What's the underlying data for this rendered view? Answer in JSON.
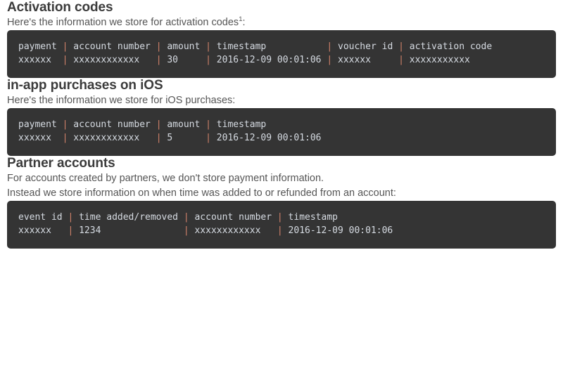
{
  "sections": [
    {
      "heading": "Activation codes",
      "intro_prefix": "Here's the information we store for activation codes",
      "intro_superscript": "1",
      "intro_suffix": ":",
      "code": {
        "header_cells": [
          "payment",
          "account number",
          "amount",
          "timestamp           ",
          "voucher id",
          "activation code"
        ],
        "value_cells": [
          "xxxxxx ",
          "xxxxxxxxxxxx ",
          "30    ",
          "2016-12-09 00:01:06",
          "xxxxxx    ",
          "xxxxxxxxxxx"
        ],
        "header_line": "payment | account number | amount | timestamp           | voucher id | activation code",
        "value_line": "xxxxxx  | xxxxxxxxxxxx   | 30     | 2016-12-09 00:01:06 | xxxxxx     | xxxxxxxxxxx"
      }
    },
    {
      "heading": "in-app purchases on iOS",
      "intro_prefix": "Here's the information we store for iOS purchases:",
      "intro_superscript": "",
      "intro_suffix": "",
      "code": {
        "header_cells": [
          "payment",
          "account number",
          "amount",
          "timestamp"
        ],
        "value_cells": [
          "xxxxxx ",
          "xxxxxxxxxxxx ",
          "5     ",
          "2016-12-09 00:01:06"
        ],
        "header_line": "payment | account number | amount | timestamp",
        "value_line": "xxxxxx  | xxxxxxxxxxxx   | 5      | 2016-12-09 00:01:06"
      }
    },
    {
      "heading": "Partner accounts",
      "intro_prefix": "For accounts created by partners, we don't store payment information.",
      "intro_line2": "Instead we store information on when time was added to or refunded from an account:",
      "intro_superscript": "",
      "intro_suffix": "",
      "code": {
        "header_cells": [
          "event id",
          "time added/removed",
          "account number",
          "timestamp"
        ],
        "value_cells": [
          "xxxxxx  ",
          "1234              ",
          "xxxxxxxxxxxx  ",
          "2016-12-09 00:01:06"
        ],
        "header_line": "event id | time added/removed | account number | timestamp",
        "value_line": "xxxxxx   | 1234               | xxxxxxxxxxxx   | 2016-12-09 00:01:06"
      }
    }
  ],
  "colors": {
    "page_background": "#ffffff",
    "heading": "#3b3b3b",
    "body_text": "#555555",
    "code_background": "#343434",
    "code_text": "#d6dbe2",
    "code_pipe": "#d4836a"
  }
}
